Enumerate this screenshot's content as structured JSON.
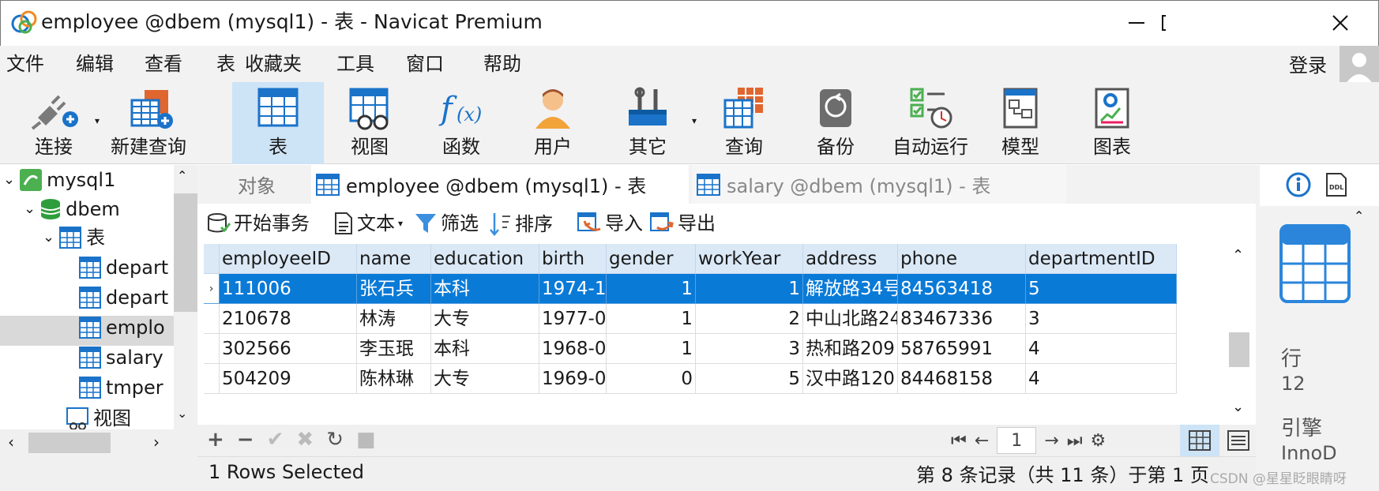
{
  "window": {
    "title": "employee @dbem (mysql1) - 表 - Navicat Premium"
  },
  "menu": [
    "文件",
    "编辑",
    "查看",
    "表",
    "收藏夹",
    "工具",
    "窗口",
    "帮助"
  ],
  "login": "登录",
  "toolbar": [
    "连接",
    "新建查询",
    "表",
    "视图",
    "函数",
    "用户",
    "其它",
    "查询",
    "备份",
    "自动运行",
    "模型",
    "图表"
  ],
  "tree": {
    "connection": "mysql1",
    "database": "dbem",
    "tables_group": "表",
    "tables": [
      "depart",
      "depart",
      "emplo",
      "salary",
      "tmper"
    ],
    "views_group": "视图"
  },
  "tabs": [
    "对象",
    "employee @dbem (mysql1) - 表",
    "salary @dbem (mysql1) - 表"
  ],
  "subtoolbar": [
    "开始事务",
    "文本",
    "筛选",
    "排序",
    "导入",
    "导出"
  ],
  "grid": {
    "columns": [
      "employeeID",
      "name",
      "education",
      "birth",
      "gender",
      "workYear",
      "address",
      "phone",
      "departmentID"
    ],
    "rows": [
      [
        "111006",
        "张石兵",
        "本科",
        "1974-1(",
        "1",
        "1",
        "解放路34号",
        "84563418",
        "5"
      ],
      [
        "210678",
        "林涛",
        "大专",
        "1977-0(",
        "1",
        "2",
        "中山北路24",
        "83467336",
        "3"
      ],
      [
        "302566",
        "李玉珉",
        "本科",
        "1968-0(",
        "1",
        "3",
        "热和路209",
        "58765991",
        "4"
      ],
      [
        "504209",
        "陈林琳",
        "大专",
        "1969-0(",
        "0",
        "5",
        "汉中路120",
        "84468158",
        "4"
      ]
    ],
    "selected_row": 0
  },
  "pager": {
    "page": "1"
  },
  "status": {
    "left": "1 Rows Selected",
    "right": "第 8 条记录（共 11 条）于第 1 页"
  },
  "info": {
    "rows_label": "行",
    "rows_value": "12",
    "engine_label": "引擎",
    "engine_value": "InnoD"
  },
  "watermark": "CSDN @星星眨眼睛呀",
  "colors": {
    "accent": "#0a7ad7",
    "header": "#dbe9f7",
    "selected_tool": "#cde3f6"
  }
}
